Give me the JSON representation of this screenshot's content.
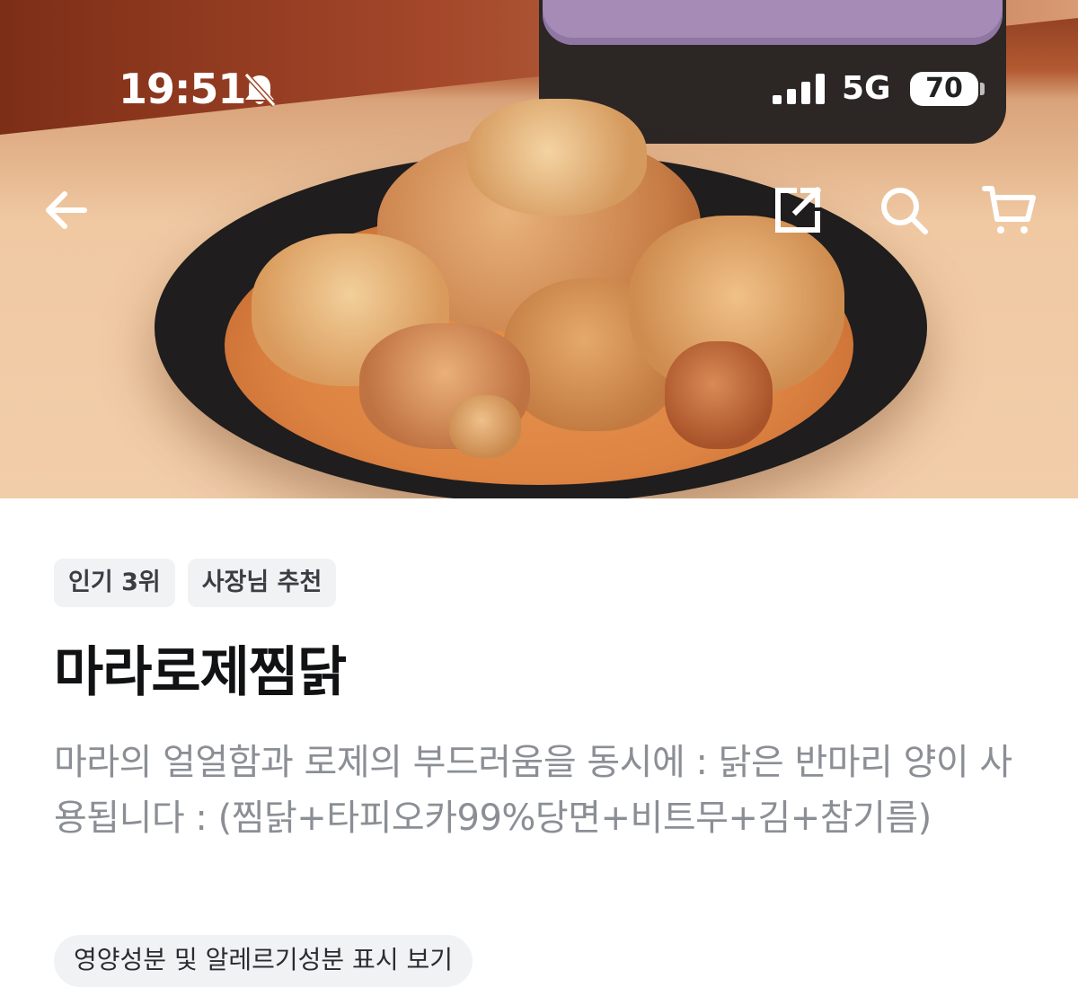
{
  "status_bar": {
    "time": "19:51",
    "network": "5G",
    "battery": "70",
    "icons": [
      "bell-muted-icon",
      "cellular-signal-icon",
      "battery-icon"
    ]
  },
  "nav": {
    "icons": [
      "back-arrow-icon",
      "share-icon",
      "search-icon",
      "cart-icon"
    ]
  },
  "product": {
    "badges": [
      "인기 3위",
      "사장님 추천"
    ],
    "name": "마라로제찜닭",
    "description": "마라의 얼얼함과 로제의 부드러움을 동시에 : 닭은 반마리 양이 사용됩니다 : (찜닭+타피오카99%당면+비트무+김+참기름)",
    "nutrition_button": "영양성분 및 알레르기성분 표시 보기"
  },
  "colors": {
    "badge_bg": "#f1f2f4",
    "title": "#111214",
    "description": "#8b8f95"
  }
}
